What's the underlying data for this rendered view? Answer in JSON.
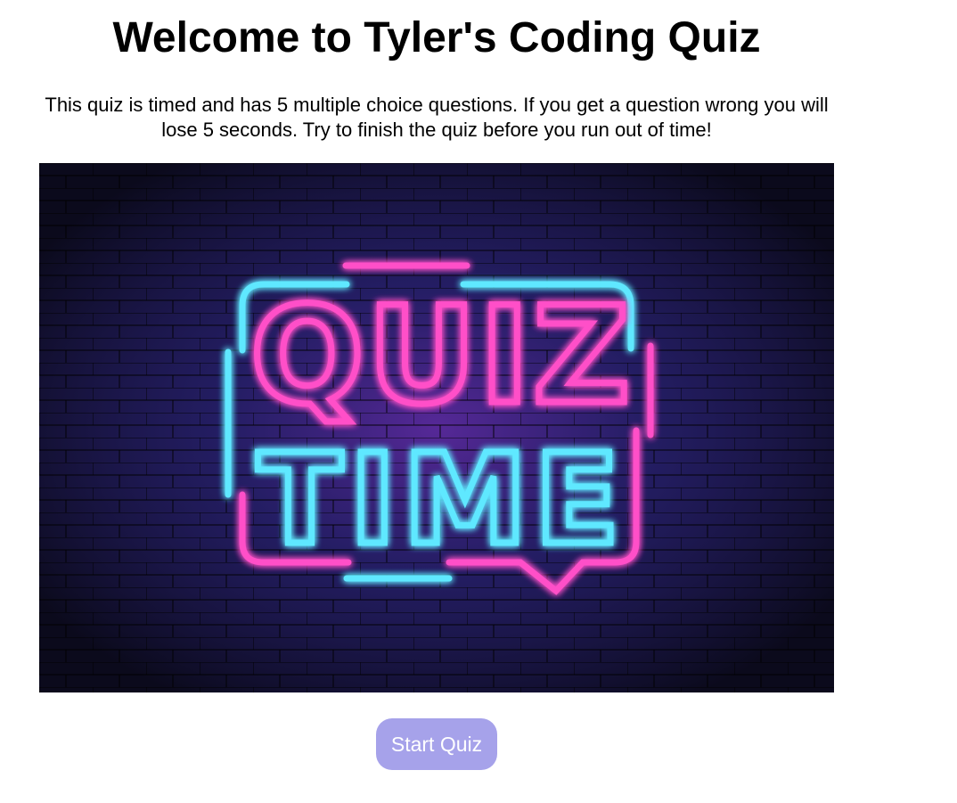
{
  "header": {
    "title": "Welcome to Tyler's Coding Quiz"
  },
  "intro": {
    "text": "This quiz is timed and has 5 multiple choice questions. If you get a question wrong you will lose 5 seconds. Try to finish the quiz before you run out of time!"
  },
  "hero_image": {
    "text_line1": "QUIZ",
    "text_line2": "TIME",
    "colors": {
      "background": "#14102e",
      "brick": "#231b4a",
      "neon_pink": "#ff3fc0",
      "neon_cyan": "#3fe0ff"
    }
  },
  "actions": {
    "start_label": "Start Quiz",
    "button_color": "#a6a2ea"
  }
}
